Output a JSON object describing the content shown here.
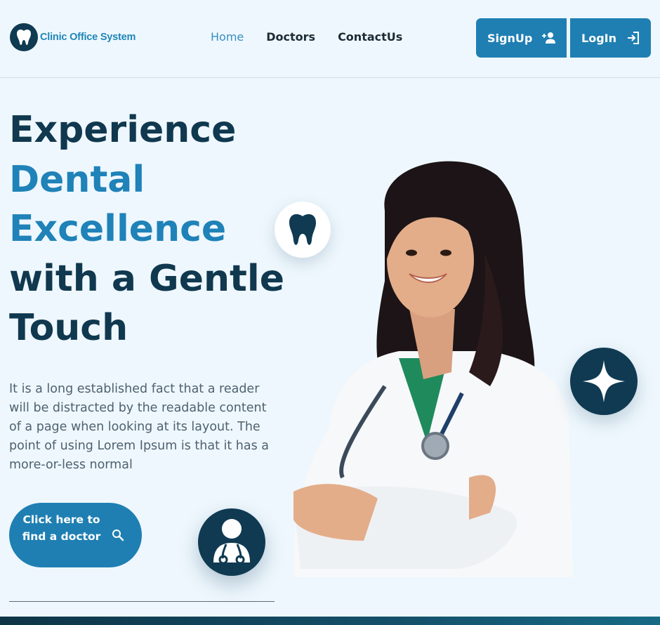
{
  "header": {
    "logo_text": "Clinic Office System",
    "nav": [
      {
        "label": "Home",
        "active": true
      },
      {
        "label": "Doctors",
        "active": false
      },
      {
        "label": "ContactUs",
        "active": false
      }
    ],
    "signup_label": "SignUp",
    "login_label": "LogIn"
  },
  "hero": {
    "title_line1": "Experience",
    "title_line2": "Dental",
    "title_line3": "Excellence",
    "title_line4": "with a Gentle",
    "title_line5": "Touch",
    "description": "It is a long established fact that a reader will be distracted by the readable content of a page when looking at its layout. The point of using Lorem Ipsum is that it has a more-or-less normal",
    "cta_label": "Click here to find a doctor"
  },
  "icons": {
    "logo": "tooth-icon",
    "signup": "person-add-icon",
    "login": "login-arrow-icon",
    "cta": "search-icon",
    "badge_top": "tooth-icon",
    "badge_right": "sparkle-icon",
    "badge_bottom": "doctor-icon"
  },
  "colors": {
    "primary": "#1f7fb3",
    "dark": "#0f3a52",
    "accent_text": "#1f82b8",
    "background": "#eef7fd"
  }
}
